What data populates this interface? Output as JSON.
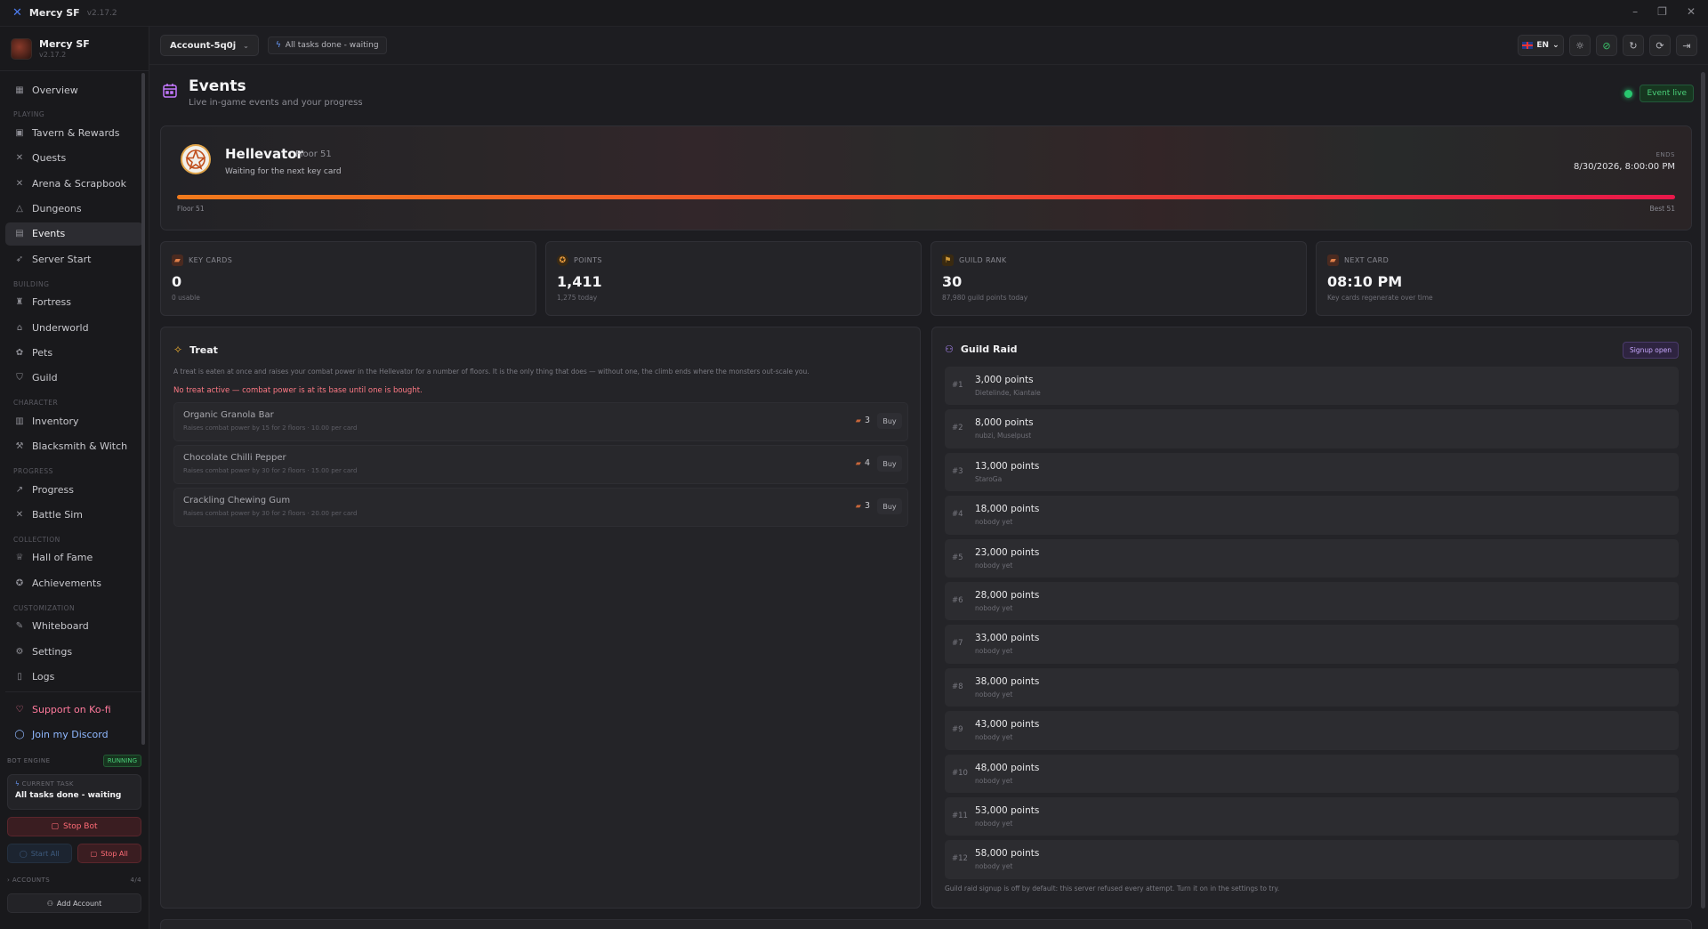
{
  "window": {
    "title": "Mercy SF",
    "version": "v2.17.2"
  },
  "profile": {
    "name": "Mercy SF",
    "version": "v2.17.2"
  },
  "nav": {
    "overview": "Overview",
    "sec_playing": "PLAYING",
    "tavern": "Tavern & Rewards",
    "quests": "Quests",
    "arena": "Arena & Scrapbook",
    "dungeons": "Dungeons",
    "events": "Events",
    "server_start": "Server Start",
    "sec_building": "BUILDING",
    "fortress": "Fortress",
    "underworld": "Underworld",
    "pets": "Pets",
    "guild": "Guild",
    "sec_character": "CHARACTER",
    "inventory": "Inventory",
    "blacksmith": "Blacksmith & Witch",
    "sec_progress": "PROGRESS",
    "progress": "Progress",
    "battle_sim": "Battle Sim",
    "sec_collection": "COLLECTION",
    "hall_of_fame": "Hall of Fame",
    "achievements": "Achievements",
    "sec_customization": "CUSTOMIZATION",
    "whiteboard": "Whiteboard",
    "settings": "Settings",
    "logs": "Logs",
    "kofi": "Support on Ko-fi",
    "discord": "Join my Discord"
  },
  "engine": {
    "label": "BOT ENGINE",
    "status": "RUNNING",
    "current_task_label": "CURRENT TASK",
    "current_task": "All tasks done - waiting",
    "stop_bot": "Stop Bot",
    "start_all": "Start All",
    "stop_all": "Stop All",
    "accounts_label": "ACCOUNTS",
    "accounts_count": "4/4",
    "add_account": "Add Account"
  },
  "topbar": {
    "account": "Account-5q0j",
    "status": "All tasks done - waiting",
    "lang": "EN"
  },
  "page": {
    "title": "Events",
    "subtitle": "Live in-game events and your progress",
    "live_badge": "Event live"
  },
  "hero": {
    "name": "Hellevator",
    "floor": "Floor 51",
    "status": "Waiting for the next key card",
    "ends_label": "ENDS",
    "ends_value": "8/30/2026, 8:00:00 PM",
    "progress_fraction": 1.0,
    "progress_left": "Floor 51",
    "progress_right": "Best 51"
  },
  "stats": [
    {
      "label": "KEY CARDS",
      "value": "0",
      "sub": "0 usable"
    },
    {
      "label": "POINTS",
      "value": "1,411",
      "sub": "1,275 today"
    },
    {
      "label": "GUILD RANK",
      "value": "30",
      "sub": "87,980 guild points today"
    },
    {
      "label": "NEXT CARD",
      "value": "08:10 PM",
      "sub": "Key cards regenerate over time"
    }
  ],
  "treat": {
    "title": "Treat",
    "description": "A treat is eaten at once and raises your combat power in the Hellevator for a number of floors. It is the only thing that does — without one, the climb ends where the monsters out-scale you.",
    "warning": "No treat active — combat power is at its base until one is bought.",
    "buy_label": "Buy",
    "items": [
      {
        "name": "Organic Granola Bar",
        "desc": "Raises combat power by 15 for 2 floors · 10.00 per card",
        "cost": "3"
      },
      {
        "name": "Chocolate Chilli Pepper",
        "desc": "Raises combat power by 30 for 2 floors · 15.00 per card",
        "cost": "4"
      },
      {
        "name": "Crackling Chewing Gum",
        "desc": "Raises combat power by 30 for 2 floors · 20.00 per card",
        "cost": "3"
      }
    ]
  },
  "raid": {
    "title": "Guild Raid",
    "badge": "Signup open",
    "footer": "Guild raid signup is off by default: this server refused every attempt. Turn it on in the settings to try.",
    "items": [
      {
        "rank": "#1",
        "points": "3,000 points",
        "names": "Dietelinde, Kiantale"
      },
      {
        "rank": "#2",
        "points": "8,000 points",
        "names": "nubzi, Muselpust"
      },
      {
        "rank": "#3",
        "points": "13,000 points",
        "names": "StaroGa"
      },
      {
        "rank": "#4",
        "points": "18,000 points",
        "names": "nobody yet"
      },
      {
        "rank": "#5",
        "points": "23,000 points",
        "names": "nobody yet"
      },
      {
        "rank": "#6",
        "points": "28,000 points",
        "names": "nobody yet"
      },
      {
        "rank": "#7",
        "points": "33,000 points",
        "names": "nobody yet"
      },
      {
        "rank": "#8",
        "points": "38,000 points",
        "names": "nobody yet"
      },
      {
        "rank": "#9",
        "points": "43,000 points",
        "names": "nobody yet"
      },
      {
        "rank": "#10",
        "points": "48,000 points",
        "names": "nobody yet"
      },
      {
        "rank": "#11",
        "points": "53,000 points",
        "names": "nobody yet"
      },
      {
        "rank": "#12",
        "points": "58,000 points",
        "names": "nobody yet"
      }
    ]
  },
  "colors": {
    "accent_purple": "#c478ff",
    "live_green": "#28c76f",
    "danger_red": "#ff6b76",
    "progress_start": "#f17a1c",
    "progress_end": "#e8184a"
  },
  "icons": {
    "app": "crossed-swords-icon",
    "calendar": "calendar-icon",
    "pentagram": "pentagram-icon",
    "key_card": "key-card-icon",
    "star_coin": "star-coin-icon",
    "guild_banner": "guild-banner-icon",
    "treat": "sparkle-treat-icon",
    "users": "users-icon"
  }
}
